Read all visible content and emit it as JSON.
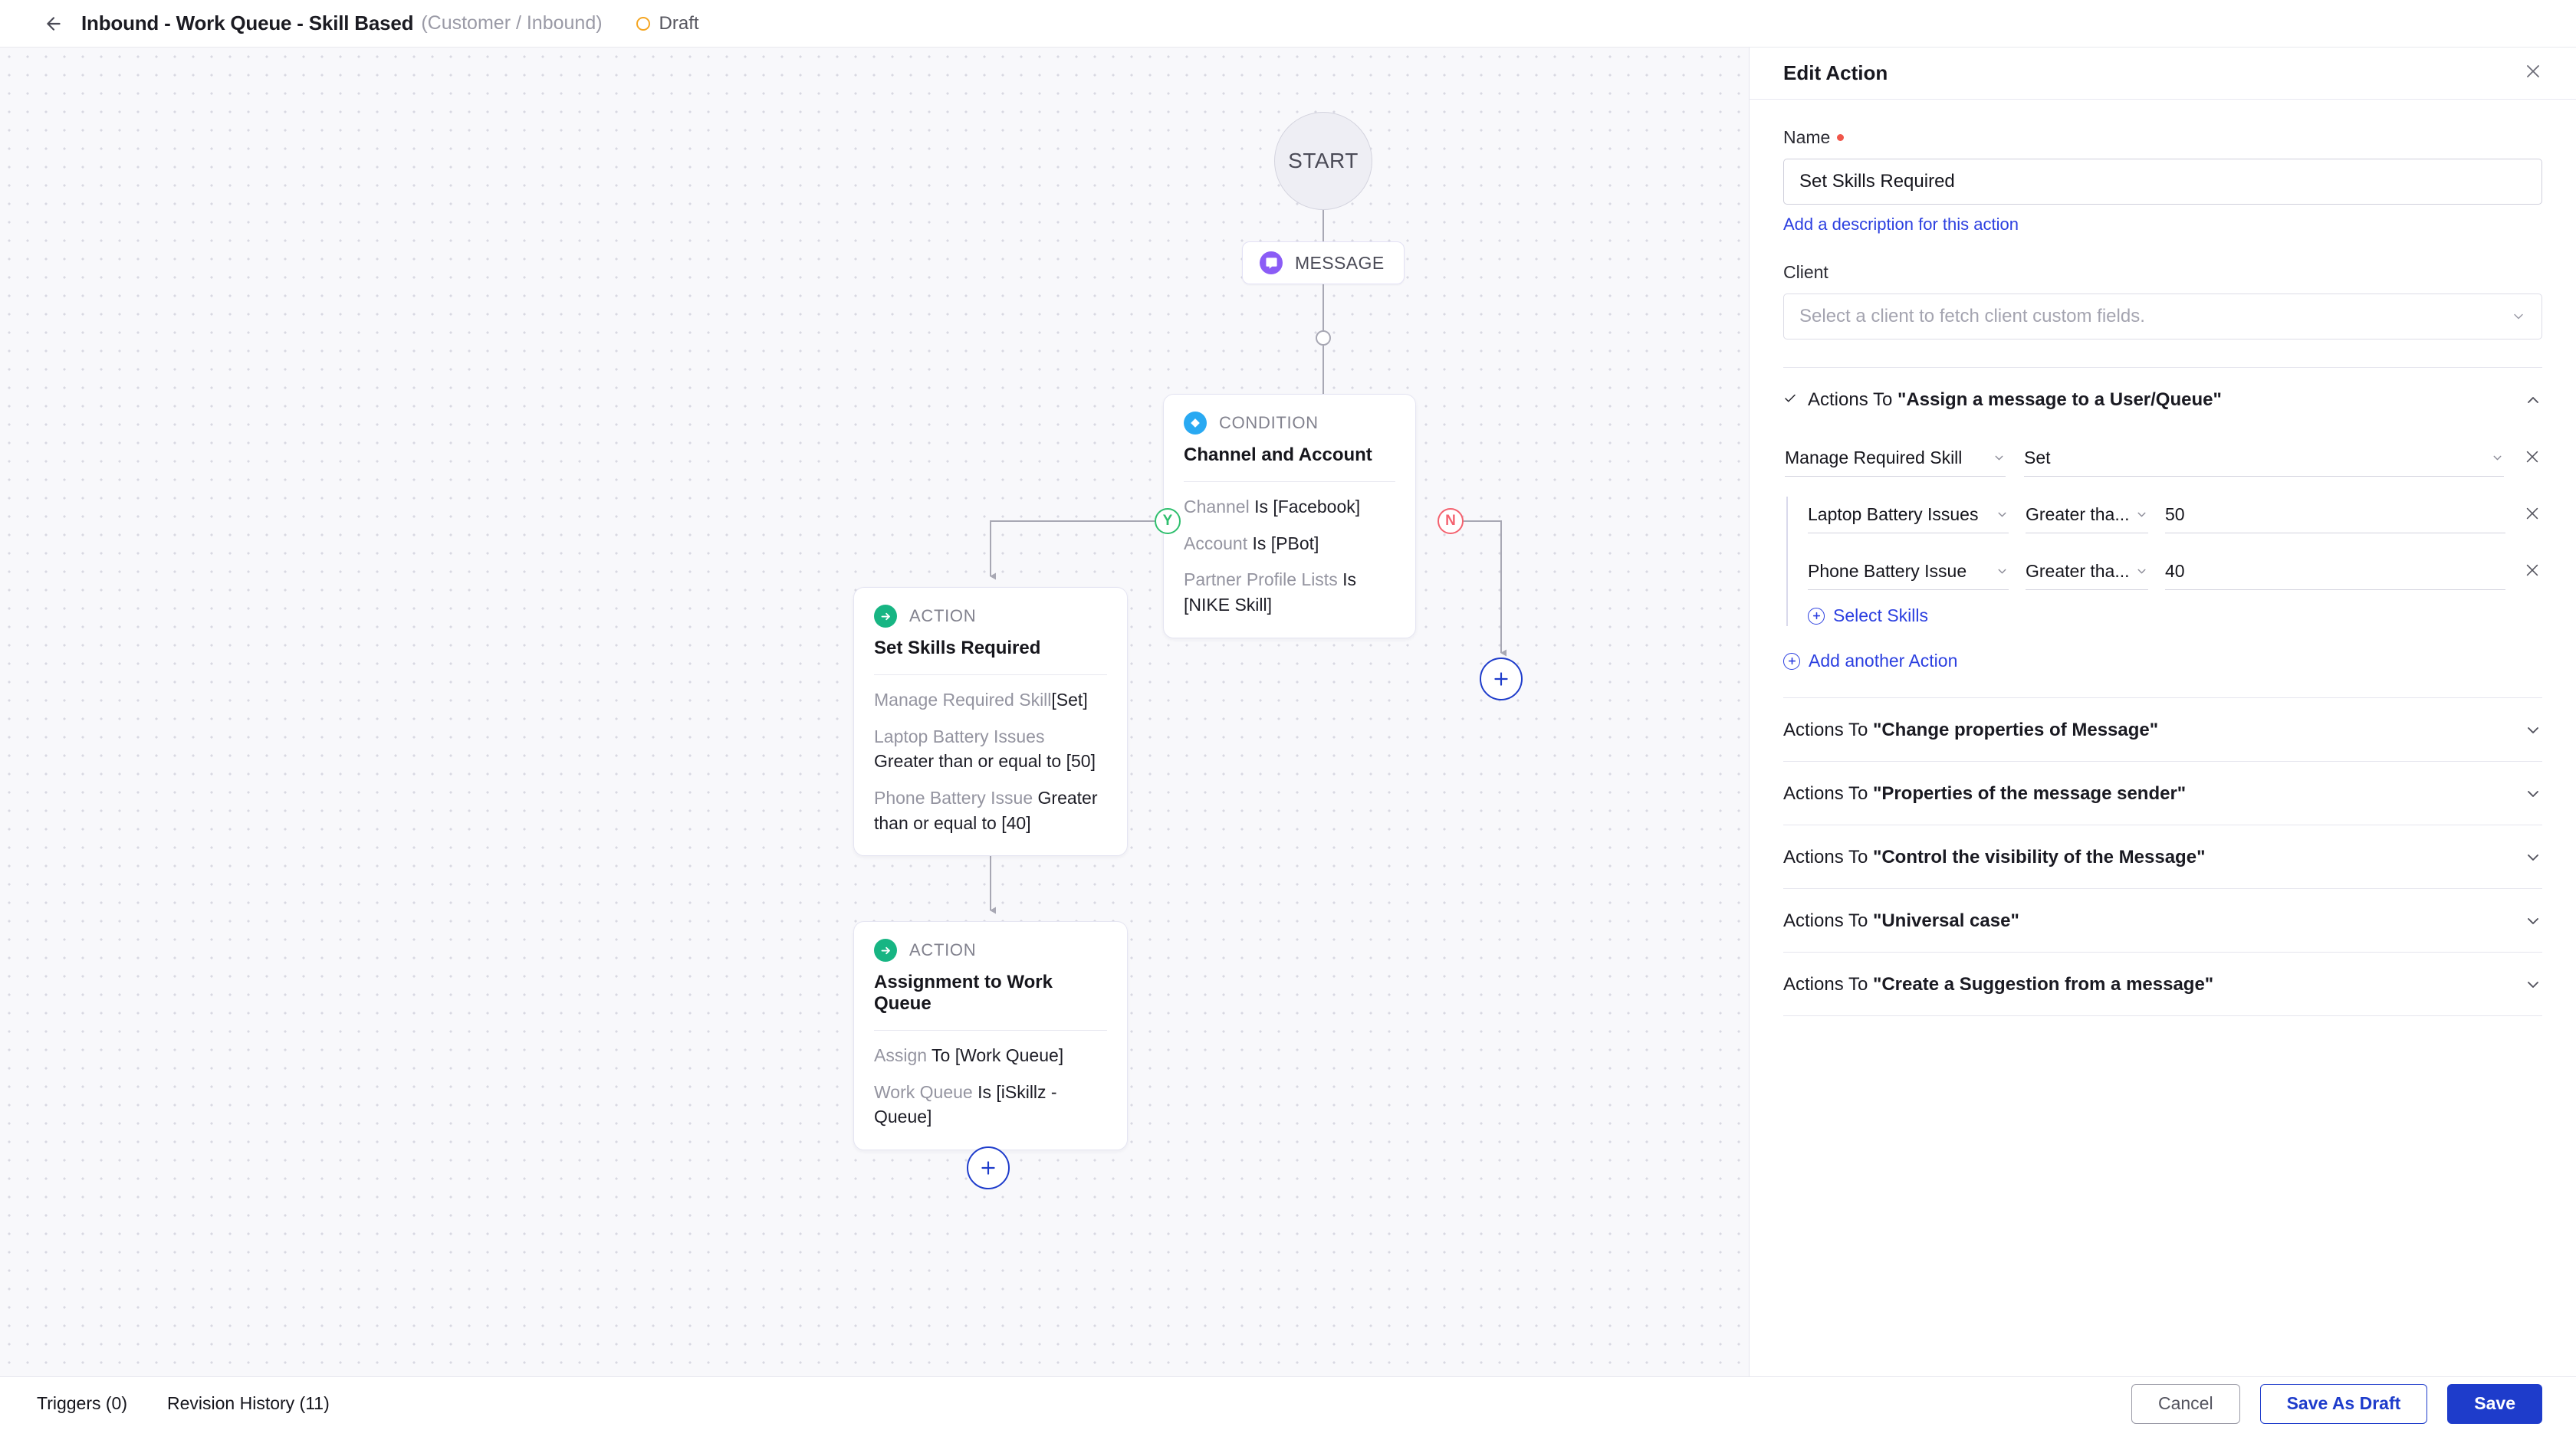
{
  "topbar": {
    "back_icon": "arrow-left-icon",
    "title": "Inbound - Work Queue - Skill Based",
    "subtitle": "(Customer / Inbound)",
    "status": "Draft",
    "status_color": "#f5a623"
  },
  "canvas": {
    "start_label": "START",
    "message_node": {
      "label": "MESSAGE",
      "icon": "chat-bubble-icon",
      "color": "#8b5cf6"
    },
    "condition_node": {
      "kind": "CONDITION",
      "title": "Channel and Account",
      "color": "#29a9f2",
      "rows": [
        {
          "key": "Channel ",
          "value": "Is [Facebook]"
        },
        {
          "key": "Account ",
          "value": "Is [PBot]"
        },
        {
          "key": "Partner Profile Lists ",
          "value": "Is [NIKE Skill]"
        }
      ]
    },
    "action_node_1": {
      "kind": "ACTION",
      "title": "Set Skills Required",
      "color": "#17b583",
      "rows": [
        {
          "key": "Manage Required Skill",
          "value": "[Set]"
        },
        {
          "key": "Laptop Battery Issues ",
          "value": "Greater than or equal to [50]"
        },
        {
          "key": "Phone Battery Issue ",
          "value": "Greater than or equal to [40]"
        }
      ]
    },
    "action_node_2": {
      "kind": "ACTION",
      "title": "Assignment to Work Queue",
      "color": "#17b583",
      "rows": [
        {
          "key": "Assign ",
          "value": "To [Work Queue]"
        },
        {
          "key": "Work Queue ",
          "value": "Is [iSkillz - Queue]"
        }
      ]
    },
    "branch_yes": "Y",
    "branch_no": "N",
    "add_node_icon": "plus-icon"
  },
  "panel": {
    "title": "Edit Action",
    "close_icon": "close-icon",
    "name_label": "Name",
    "name_value": "Set Skills Required",
    "description_link": "Add a description for this action",
    "client_label": "Client",
    "client_placeholder": "Select a client to fetch client custom fields.",
    "assign_section": {
      "prefix": "Actions To ",
      "name": "\"Assign a message to a User/Queue\"",
      "check_icon": "check-icon",
      "chevron": "chevron-up-icon",
      "skill_mode_field": "Manage Required Skill",
      "skill_mode_value": "Set",
      "remove_icon": "close-icon",
      "skill_rows": [
        {
          "skill": "Laptop Battery Issues",
          "operator": "Greater tha...",
          "value": "50"
        },
        {
          "skill": "Phone Battery Issue",
          "operator": "Greater tha...",
          "value": "40"
        }
      ],
      "select_skills_link": "Select Skills",
      "add_action_link": "Add another Action"
    },
    "collapsed_sections": [
      {
        "prefix": "Actions To ",
        "name": "\"Change properties of Message\""
      },
      {
        "prefix": "Actions To ",
        "name": "\"Properties of the message sender\""
      },
      {
        "prefix": "Actions To ",
        "name": "\"Control the visibility of the Message\""
      },
      {
        "prefix": "Actions To ",
        "name": "\"Universal case\""
      },
      {
        "prefix": "Actions To ",
        "name": "\"Create a Suggestion from a message\""
      }
    ]
  },
  "footer": {
    "triggers": "Triggers (0)",
    "revision_history": "Revision History (11)",
    "cancel": "Cancel",
    "save_draft": "Save As Draft",
    "save": "Save",
    "accent": "#1e3ccb"
  }
}
